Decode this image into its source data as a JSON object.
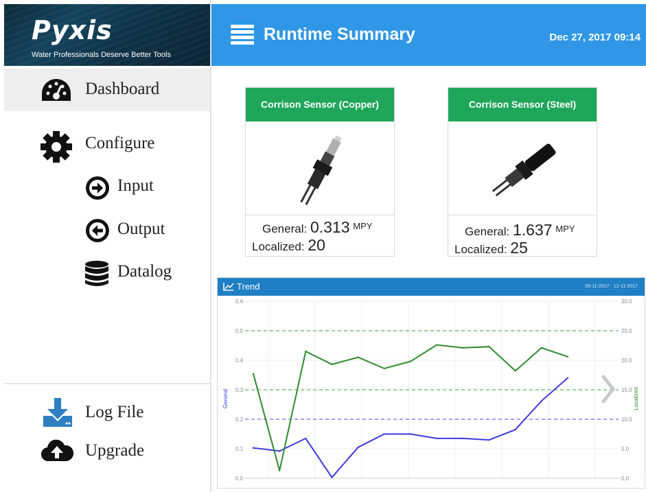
{
  "brand": {
    "name": "Pyxis",
    "tagline": "Water Professionals Deserve Better Tools"
  },
  "sidebar": {
    "items": [
      {
        "label": "Dashboard",
        "icon": "dashboard-gauge-icon",
        "active": true
      },
      {
        "label": "Configure",
        "icon": "gear-icon"
      },
      {
        "label": "Input",
        "icon": "arrow-circle-right-icon"
      },
      {
        "label": "Output",
        "icon": "arrow-circle-left-icon"
      },
      {
        "label": "Datalog",
        "icon": "database-icon"
      }
    ],
    "bottom_items": [
      {
        "label": "Log File",
        "icon": "download-tray-icon"
      },
      {
        "label": "Upgrade",
        "icon": "cloud-upload-icon"
      }
    ]
  },
  "header": {
    "title": "Runtime Summary",
    "datetime": "Dec 27, 2017 09:14",
    "menu_icon": "hamburger-menu-icon",
    "color": "#2f97e6"
  },
  "cards": [
    {
      "title": "Corrison Sensor (Copper)",
      "general_label": "General:",
      "general_value": "0.313",
      "general_unit": "MPY",
      "localized_label": "Localized:",
      "localized_value": "20",
      "header_color": "#20a65a"
    },
    {
      "title": "Corrison Sensor (Steel)",
      "general_label": "General:",
      "general_value": "1.637",
      "general_unit": "MPY",
      "localized_label": "Localized:",
      "localized_value": "25",
      "header_color": "#20a65a"
    }
  ],
  "trend": {
    "title": "Trend",
    "range": "05-11-2017 - 12-11-2017",
    "next_icon": "chevron-right-icon"
  },
  "chart_data": {
    "type": "line",
    "y_left_label": "General",
    "y_right_label": "Localized",
    "y_left_range": [
      0,
      0.6
    ],
    "y_right_range": [
      0,
      30
    ],
    "y_left_ticks": [
      "0.0",
      "0.1",
      "0.2",
      "0.3",
      "0.4",
      "0.5",
      "0.6"
    ],
    "y_right_ticks": [
      "0.0",
      "5.0",
      "10.0",
      "15.0",
      "20.0",
      "25.0",
      "30.0"
    ],
    "reference_lines": {
      "general": 0.2,
      "localized": [
        15,
        25
      ]
    },
    "series": [
      {
        "name": "General",
        "axis": "left",
        "color": "#3b3bdc",
        "values": [
          0.103,
          0.092,
          0.135,
          0.003,
          0.105,
          0.15,
          0.15,
          0.135,
          0.135,
          0.13,
          0.165,
          0.262,
          0.34
        ]
      },
      {
        "name": "Localized",
        "axis": "right",
        "color": "#2e8a2e",
        "values": [
          17.7,
          1.3,
          21.5,
          19.3,
          20.5,
          18.6,
          19.8,
          22.6,
          22.1,
          22.3,
          18.2,
          22.1,
          20.6
        ]
      }
    ],
    "grid": true
  },
  "colors": {
    "general_line": "#3b3bdc",
    "localized_line": "#2e8a2e",
    "trend_header": "#1f7fc4"
  }
}
